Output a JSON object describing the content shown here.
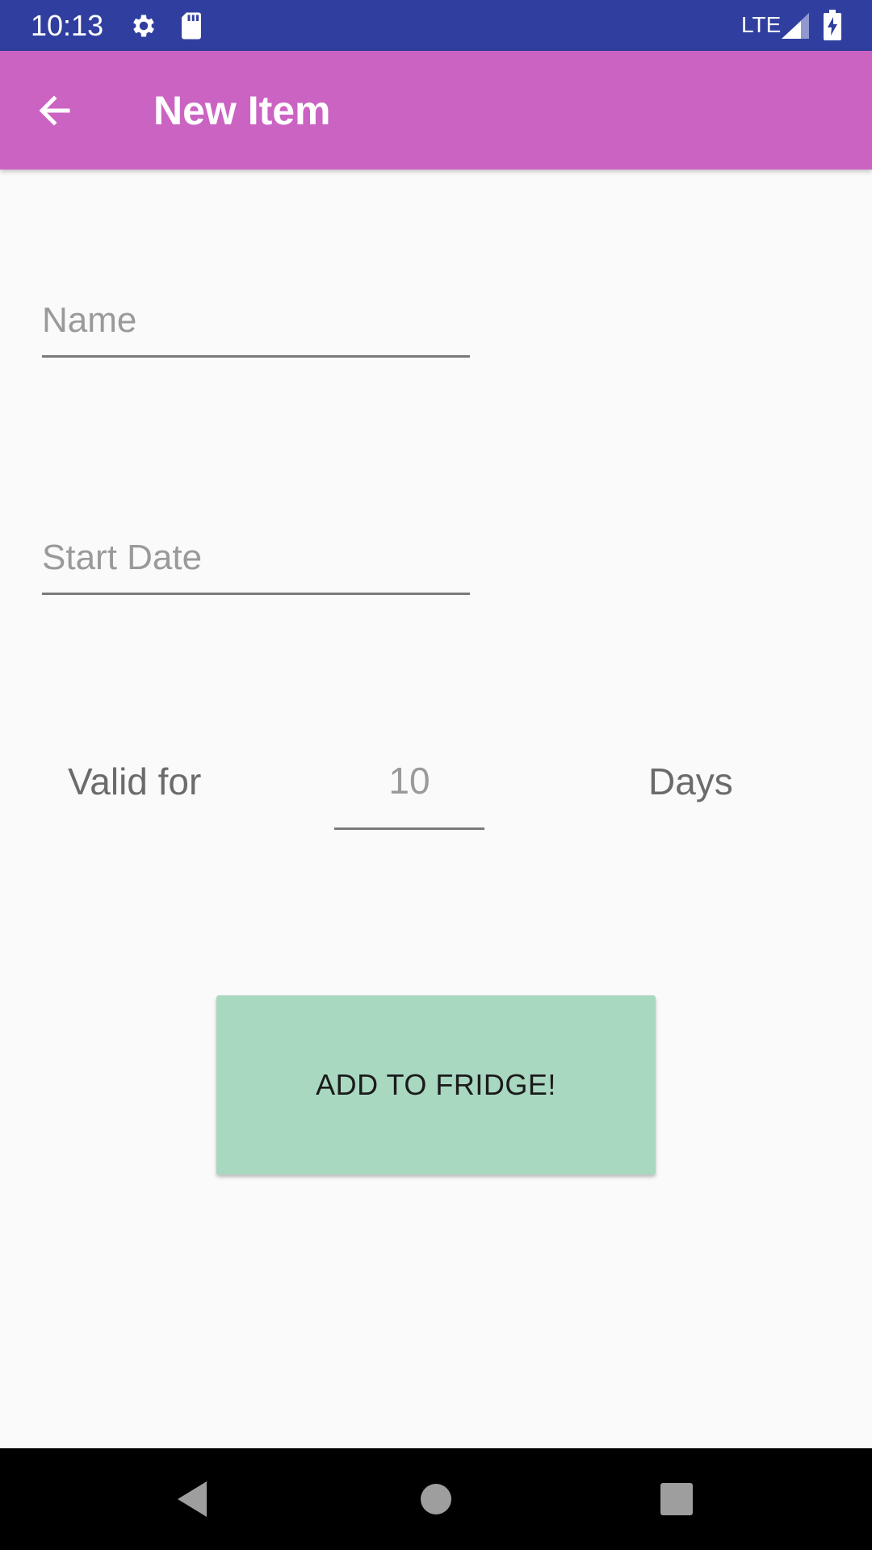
{
  "status_bar": {
    "time": "10:13",
    "network": "LTE",
    "icons": [
      "gear-icon",
      "sd-card-icon",
      "signal-icon",
      "battery-charging-icon"
    ],
    "background": "#303f9f"
  },
  "app_bar": {
    "title": "New Item",
    "back_icon": "arrow-left-icon",
    "background": "#cb63c3"
  },
  "form": {
    "name_placeholder": "Name",
    "name_value": "",
    "start_date_placeholder": "Start Date",
    "start_date_value": "",
    "valid_for_label": "Valid for",
    "days_value": "10",
    "days_label": "Days"
  },
  "add_button": {
    "label": "ADD TO FRIDGE!",
    "background": "#a9d8c1"
  },
  "nav_bar": {
    "icons": [
      "back-triangle-icon",
      "home-circle-icon",
      "recents-square-icon"
    ]
  }
}
